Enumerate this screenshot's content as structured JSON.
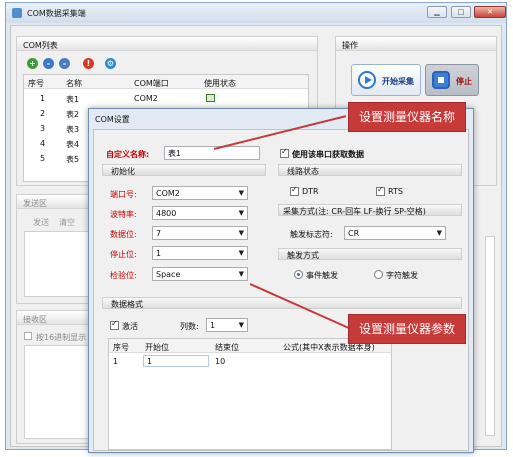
{
  "window": {
    "title": "COM数据采集端"
  },
  "com_list": {
    "title": "COM列表",
    "columns": [
      "序号",
      "名称",
      "COM端口",
      "使用状态"
    ],
    "rows": [
      {
        "no": "1",
        "name": "表1",
        "port": "COM2"
      },
      {
        "no": "2",
        "name": "表2",
        "port": ""
      },
      {
        "no": "3",
        "name": "表3",
        "port": ""
      },
      {
        "no": "4",
        "name": "表4",
        "port": ""
      },
      {
        "no": "5",
        "name": "表5",
        "port": ""
      }
    ]
  },
  "operation": {
    "title": "操作",
    "start": "开始采集",
    "stop": "停止"
  },
  "send": {
    "title": "发送区",
    "send_btn": "发送",
    "clear_btn": "清空"
  },
  "receive": {
    "title": "接收区",
    "hex_label": "按16进制显示"
  },
  "dialog": {
    "title": "COM设置",
    "name_label": "自定义名称:",
    "name_value": "表1",
    "use_port_label": "使用该串口获取数据",
    "init_title": "初始化",
    "line_title": "线路状态",
    "port_label": "端口号:",
    "port_value": "COM2",
    "baud_label": "波特率:",
    "baud_value": "4800",
    "databits_label": "数据位:",
    "databits_value": "7",
    "stopbits_label": "停止位:",
    "stopbits_value": "1",
    "parity_label": "检验位:",
    "parity_value": "Space",
    "dtr_label": "DTR",
    "rts_label": "RTS",
    "collect_mode_label": "采集方式(注: CR-回车 LF-换行 SP-空格)",
    "trigger_char_label": "触发标志符:",
    "trigger_char_value": "CR",
    "trigger_mode_title": "触发方式",
    "event_trigger": "事件触发",
    "char_trigger": "字符触发",
    "format_title": "数据格式",
    "activate_label": "激活",
    "column_count_label": "列数:",
    "column_count_value": "1",
    "format_columns": [
      "序号",
      "开始位",
      "结束位",
      "公式(其中X表示数据本身)"
    ],
    "format_row": [
      "1",
      "1",
      "10",
      ""
    ]
  },
  "callouts": {
    "name": "设置测量仪器名称",
    "params": "设置测量仪器参数"
  },
  "colors": {
    "callout": "#c73a3a",
    "label_red": "#cc0000",
    "accent": "#2a6dd0"
  }
}
